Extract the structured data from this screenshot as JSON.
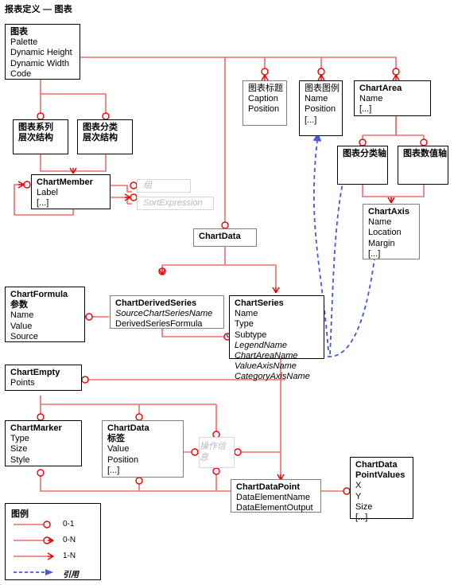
{
  "page": {
    "title": "报表定义 — 图表"
  },
  "boxes": [
    {
      "id": "chart",
      "header": "图表",
      "attrs": [
        "Palette",
        "Dynamic Height",
        "Dynamic Width",
        "Code"
      ]
    },
    {
      "id": "chart-series-hierarchy",
      "header": "图表系列",
      "attrs": [
        "层次结构"
      ]
    },
    {
      "id": "chart-category-hierarchy",
      "header": "图表分类",
      "attrs": [
        "层次结构"
      ]
    },
    {
      "id": "chart-member",
      "header": "ChartMember",
      "attrs": [
        "Label",
        "[...]"
      ]
    },
    {
      "id": "group-ghost",
      "header": "组",
      "attrs": []
    },
    {
      "id": "sort-expression-ghost",
      "header": "SortExpression",
      "attrs": []
    },
    {
      "id": "chart-title",
      "header": "图表标题",
      "attrs": [
        "Caption",
        "Position"
      ]
    },
    {
      "id": "chart-legend",
      "header": "图表图例",
      "attrs": [
        "Name",
        "Position",
        "[...]"
      ]
    },
    {
      "id": "chart-area",
      "header": "ChartArea",
      "attrs": [
        "Name",
        "[...]"
      ]
    },
    {
      "id": "chart-category-axis",
      "header": "图表分类轴",
      "attrs": []
    },
    {
      "id": "chart-value-axis",
      "header": "图表数值轴",
      "attrs": []
    },
    {
      "id": "chart-axis",
      "header": "ChartAxis",
      "attrs": [
        "Name",
        "Location",
        "Margin",
        "[...]"
      ]
    },
    {
      "id": "chart-data-top",
      "header": "ChartData",
      "attrs": []
    },
    {
      "id": "chart-formula",
      "header": "ChartFormula",
      "attrs": [
        "参数",
        "Name",
        "Value",
        "Source"
      ]
    },
    {
      "id": "chart-derived-series",
      "header": "ChartDerivedSeries",
      "attrs": [
        "SourceChartSeriesName",
        "DerivedSeriesFormula"
      ]
    },
    {
      "id": "chart-series",
      "header": "ChartSeries",
      "attrs": [
        "Name",
        "Type",
        "Subtype",
        "LegendName",
        "ChartAreaName",
        "ValueAxisName",
        "CategoryAxisName"
      ]
    },
    {
      "id": "chart-empty",
      "header": "ChartEmpty",
      "attrs": [
        "Points"
      ]
    },
    {
      "id": "chart-marker",
      "header": "ChartMarker",
      "attrs": [
        "Type",
        "Size",
        "Style"
      ]
    },
    {
      "id": "chart-data-label",
      "header": "ChartData",
      "attrs": [
        "标签",
        "Value",
        "Position",
        "[...]"
      ]
    },
    {
      "id": "action-info-ghost",
      "header": "操作信息",
      "attrs": []
    },
    {
      "id": "chart-data-point",
      "header": "ChartDataPoint",
      "attrs": [
        "DataElementName",
        "DataElementOutput"
      ]
    },
    {
      "id": "chart-data-point-values",
      "header": "ChartData",
      "header2": "PointValues",
      "attrs": [
        "X",
        "Y",
        "Size",
        "[...]"
      ]
    }
  ],
  "labels": {
    "chart": {
      "header": "图表",
      "a0": "Palette",
      "a1": "Dynamic Height",
      "a2": "Dynamic Width",
      "a3": "Code"
    },
    "chart_series_hierarchy": {
      "h": "图表系列",
      "a0": "层次结构"
    },
    "chart_category_hierarchy": {
      "h": "图表分类",
      "a0": "层次结构"
    },
    "chart_member": {
      "h": "ChartMember",
      "a0": "Label",
      "a1": "[...]"
    },
    "group_ghost": {
      "h": "组"
    },
    "sort_expression_ghost": {
      "h": "SortExpression"
    },
    "chart_title": {
      "h": "图表标题",
      "a0": "Caption",
      "a1": "Position"
    },
    "chart_legend": {
      "h": "图表图例",
      "a0": "Name",
      "a1": "Position",
      "a2": "[...]"
    },
    "chart_area": {
      "h": "ChartArea",
      "a0": "Name",
      "a1": "[...]"
    },
    "chart_category_axis": {
      "h": "图表分类轴"
    },
    "chart_value_axis": {
      "h": "图表数值轴"
    },
    "chart_axis": {
      "h": "ChartAxis",
      "a0": "Name",
      "a1": "Location",
      "a2": "Margin",
      "a3": "[...]"
    },
    "chart_data_top": {
      "h": "ChartData"
    },
    "chart_formula": {
      "h": "ChartFormula",
      "a0": "参数",
      "a1": "Name",
      "a2": "Value",
      "a3": "Source"
    },
    "chart_derived_series": {
      "h": "ChartDerivedSeries",
      "a0": "SourceChartSeriesName",
      "a1": "DerivedSeriesFormula"
    },
    "chart_series": {
      "h": "ChartSeries",
      "a0": "Name",
      "a1": "Type",
      "a2": "Subtype",
      "a3": "LegendName",
      "a4": "ChartAreaName",
      "a5": "ValueAxisName",
      "a6": "CategoryAxisName"
    },
    "chart_empty": {
      "h": "ChartEmpty",
      "a0": "Points"
    },
    "chart_marker": {
      "h": "ChartMarker",
      "a0": "Type",
      "a1": "Size",
      "a2": "Style"
    },
    "chart_data_label": {
      "h": "ChartData",
      "a0": "标签",
      "a1": "Value",
      "a2": "Position",
      "a3": "[...]"
    },
    "action_info_ghost": {
      "h": "操作信息"
    },
    "chart_data_point": {
      "h": "ChartDataPoint",
      "a0": "DataElementName",
      "a1": "DataElementOutput"
    },
    "chart_data_point_values": {
      "h": "ChartData",
      "h2": "PointValues",
      "a0": "X",
      "a1": "Y",
      "a2": "Size",
      "a3": "[...]"
    }
  },
  "legend": {
    "title": "图例",
    "items": [
      {
        "key": "zero-one",
        "label": "0-1"
      },
      {
        "key": "zero-n",
        "label": "0-N"
      },
      {
        "key": "one-n",
        "label": "1-N"
      },
      {
        "key": "reference",
        "label": "引用"
      }
    ]
  },
  "colors": {
    "relation": "#f46a6a",
    "relation_marker": "#ee0000",
    "reference": "#4357e8",
    "box_border": "#000000",
    "box_border_gray": "#808080",
    "ghost_border": "#d8d8d8",
    "ghost_text": "#b9b9b9",
    "background": "#ffffff"
  }
}
